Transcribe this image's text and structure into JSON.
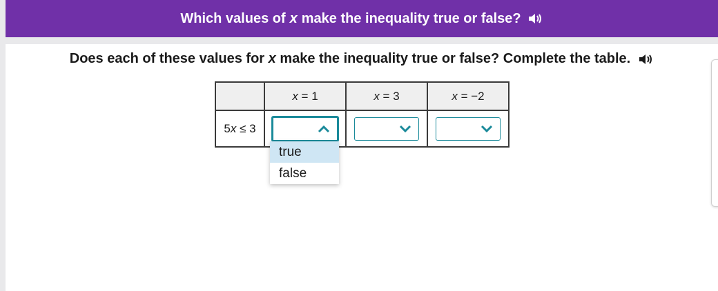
{
  "header": {
    "title_pre": "Which values of",
    "title_var": "x",
    "title_post": "make the inequality true or false?",
    "audio_icon": "speaker-icon"
  },
  "question": {
    "pre": "Does each of these values for",
    "var": "x",
    "post": "make the inequality true or false? Complete the table.",
    "audio_icon": "speaker-icon"
  },
  "table": {
    "columns": [
      {
        "var": "x",
        "rest": " = 1"
      },
      {
        "var": "x",
        "rest": " = 3"
      },
      {
        "var": "x",
        "rest": " = −2"
      }
    ],
    "row": {
      "pre": "5",
      "var": "x",
      "post": " ≤ 3"
    },
    "selects": [
      {
        "state": "open",
        "icon": "chevron-up-icon",
        "value": ""
      },
      {
        "state": "closed",
        "icon": "chevron-down-icon",
        "value": ""
      },
      {
        "state": "closed",
        "icon": "chevron-down-icon",
        "value": ""
      }
    ]
  },
  "dropdown": {
    "options": [
      "true",
      "false"
    ],
    "highlighted": "true"
  },
  "colors": {
    "header_bg": "#7030a8",
    "select_border": "#1a8a9a",
    "option_highlight": "#cfe6f4"
  }
}
